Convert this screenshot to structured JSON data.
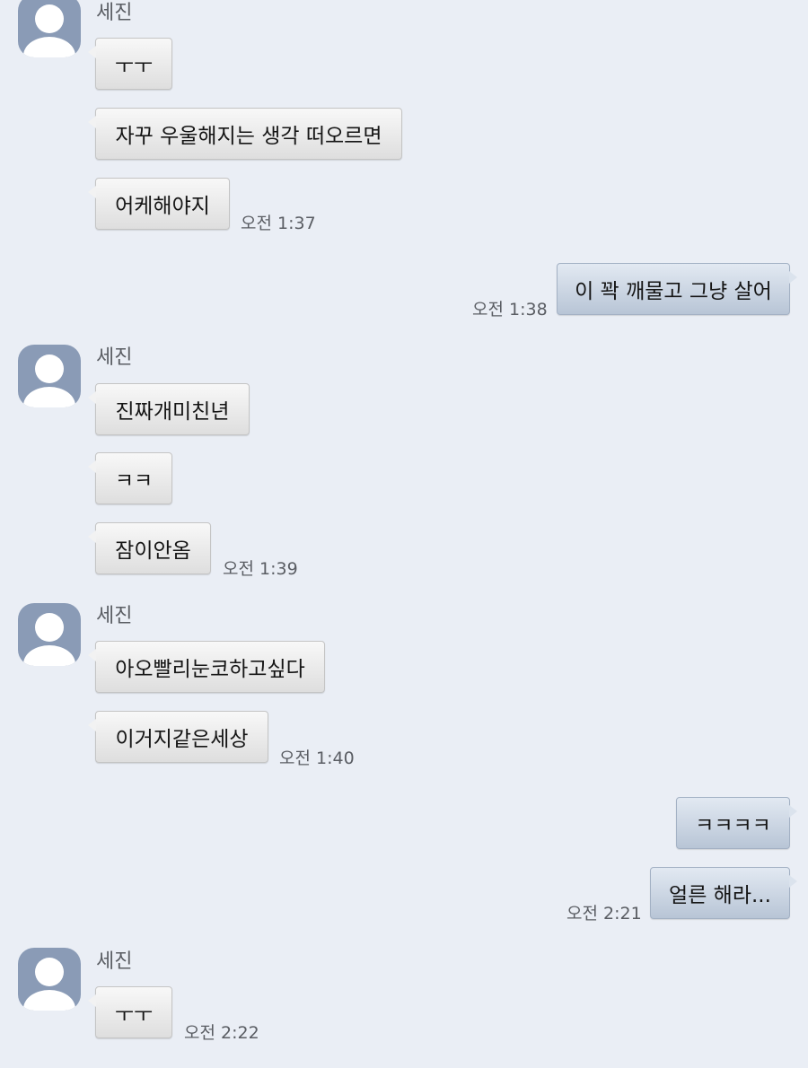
{
  "sender": "세진",
  "colors": {
    "background": "#eaeef5",
    "incoming_bubble": "#f0f0f0",
    "outgoing_bubble": "#cbd5e3",
    "avatar": "#8a9bb6"
  },
  "icons": {
    "avatar": "default-profile-avatar-icon"
  },
  "groups": [
    {
      "name": "세진",
      "messages": [
        "ㅜㅜ",
        "자꾸 우울해지는 생각 떠오르면",
        "어케해야지"
      ],
      "time": "오전 1:37"
    },
    {
      "messages": [
        "이 꽉 깨물고 그냥 살어"
      ],
      "time": "오전 1:38"
    },
    {
      "name": "세진",
      "messages": [
        "진짜개미친년",
        "ㅋㅋ",
        "잠이안옴"
      ],
      "time": "오전 1:39"
    },
    {
      "name": "세진",
      "messages": [
        "아오빨리눈코하고싶다",
        "이거지같은세상"
      ],
      "time": "오전 1:40"
    },
    {
      "messages": [
        "ㅋㅋㅋㅋ",
        "얼른 해라..."
      ],
      "time": "오전 2:21"
    },
    {
      "name": "세진",
      "messages": [
        "ㅜㅜ"
      ],
      "time": "오전 2:22"
    }
  ]
}
